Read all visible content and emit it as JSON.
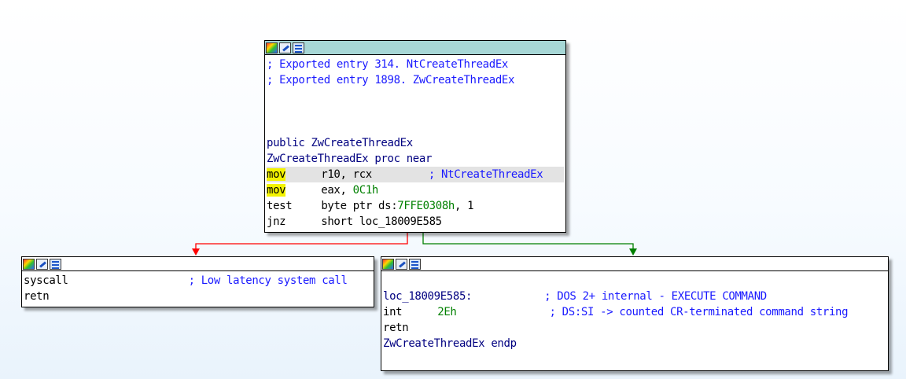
{
  "top_block": {
    "comment1": "; Exported entry 314. NtCreateThreadEx",
    "comment2": "; Exported entry 1898. ZwCreateThreadEx",
    "public_line": "public ZwCreateThreadEx",
    "proc_line": "ZwCreateThreadEx proc near",
    "rows": [
      {
        "mnemonic": "mov",
        "operands": "r10, rcx",
        "value": "",
        "comment": "; NtCreateThreadEx"
      },
      {
        "mnemonic": "mov",
        "operands": "eax, ",
        "value": "0C1h",
        "comment": ""
      },
      {
        "mnemonic": "test",
        "operands": "byte ptr ds:",
        "value": "7FFE0308h",
        "suffix": ", 1"
      },
      {
        "mnemonic": "jnz",
        "operands": "short loc_18009E585"
      }
    ]
  },
  "left_block": {
    "row1_mnemonic": "syscall",
    "row1_comment": "; Low latency system call",
    "row2_mnemonic": "retn"
  },
  "right_block": {
    "label": "loc_18009E585:",
    "label_comment": "; DOS 2+ internal - EXECUTE COMMAND",
    "int_mnemonic": "int",
    "int_value": "2Eh",
    "int_comment": "; DS:SI -> counted CR-terminated command string",
    "retn": "retn",
    "endp": "ZwCreateThreadEx endp"
  },
  "colors": {
    "header_selected": "#a7d7d6",
    "false_branch": "#ff0000",
    "true_branch": "#008000",
    "highlight": "#f3f300"
  },
  "icons": [
    "color-icon",
    "rename-icon",
    "graph-icon"
  ]
}
